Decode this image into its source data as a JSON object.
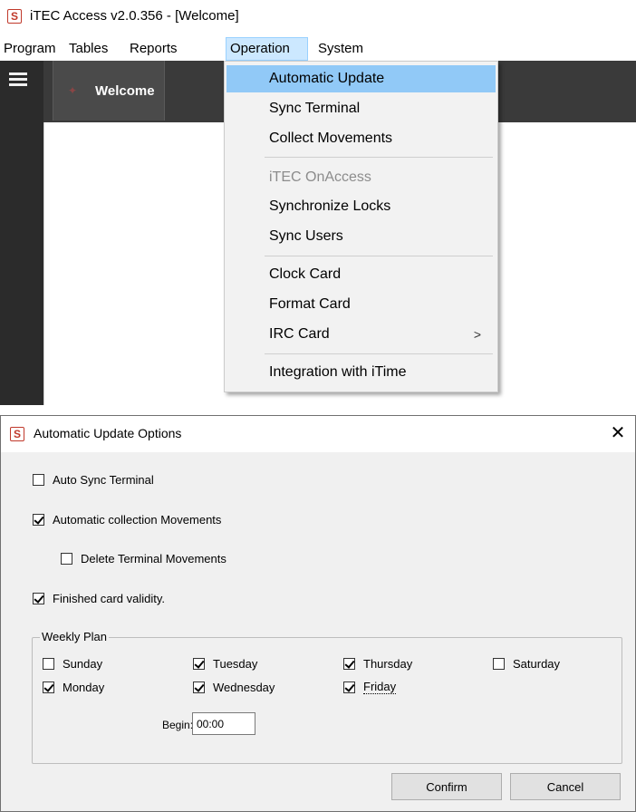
{
  "app": {
    "title": "iTEC Access v2.0.356 - [Welcome]",
    "logo_glyph": "S"
  },
  "menubar": {
    "items": [
      "Program",
      "Tables",
      "Reports",
      "Operation",
      "System"
    ],
    "active": "Operation"
  },
  "tabs": {
    "welcome_label": "Welcome"
  },
  "operation_menu": {
    "items": [
      {
        "label": "Automatic Update",
        "state": "highlighted"
      },
      {
        "label": "Sync Terminal",
        "state": "normal"
      },
      {
        "label": "Collect Movements",
        "state": "normal"
      },
      {
        "label": "iTEC OnAccess",
        "state": "disabled"
      },
      {
        "label": "Synchronize Locks",
        "state": "normal"
      },
      {
        "label": "Sync Users",
        "state": "normal"
      },
      {
        "label": "Clock Card",
        "state": "normal"
      },
      {
        "label": "Format Card",
        "state": "normal"
      },
      {
        "label": "IRC Card",
        "state": "normal",
        "submenu_arrow": ">"
      },
      {
        "label": "Integration with iTime",
        "state": "normal"
      }
    ]
  },
  "dialog": {
    "title": "Automatic Update Options",
    "close_glyph": "✕",
    "options": {
      "auto_sync_terminal": {
        "label": "Auto Sync Terminal",
        "checked": false
      },
      "automatic_collection": {
        "label": "Automatic collection Movements",
        "checked": true
      },
      "delete_terminal_movements": {
        "label": "Delete Terminal Movements",
        "checked": false
      },
      "finished_card_validity": {
        "label": "Finished card validity.",
        "checked": true
      }
    },
    "weekly_plan": {
      "legend": "Weekly Plan",
      "days": {
        "sunday": {
          "label": "Sunday",
          "checked": false
        },
        "monday": {
          "label": "Monday",
          "checked": true
        },
        "tuesday": {
          "label": "Tuesday",
          "checked": true
        },
        "wednesday": {
          "label": "Wednesday",
          "checked": true
        },
        "thursday": {
          "label": "Thursday",
          "checked": true
        },
        "friday": {
          "label": "Friday",
          "checked": true
        },
        "saturday": {
          "label": "Saturday",
          "checked": false
        }
      },
      "begin_label": "Begin:",
      "begin_value": "00:00"
    },
    "confirm_label": "Confirm",
    "cancel_label": "Cancel"
  },
  "colors": {
    "menu_highlight": "#91c9f7",
    "menubar_active": "#cce8ff",
    "sidebar_bg": "#2b2b2b",
    "logo_red": "#c0392b"
  }
}
